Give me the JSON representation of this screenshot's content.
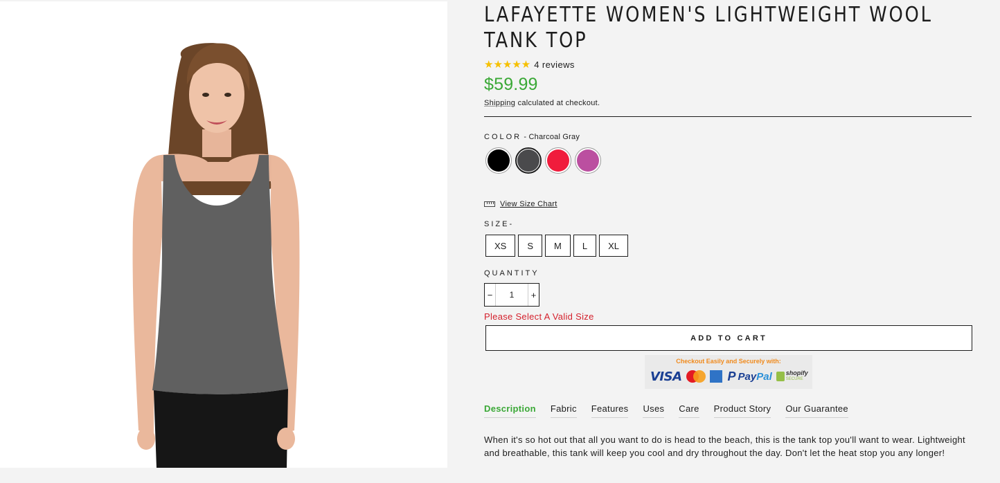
{
  "product": {
    "title": "LAFAYETTE WOMEN'S LIGHTWEIGHT WOOL TANK TOP",
    "stars": "★★★★★",
    "rating": 5,
    "reviews": "4 reviews",
    "price": "$59.99",
    "shipping_link": "Shipping",
    "shipping_text": " calculated at checkout.",
    "image_icon": "model-wearing-tank-top-photo"
  },
  "color": {
    "label": "COLOR",
    "separator": " - ",
    "selected": "Charcoal Gray",
    "swatches": [
      {
        "name": "Black",
        "hex": "#000000"
      },
      {
        "name": "Charcoal Gray",
        "hex": "#4a4a4c"
      },
      {
        "name": "Red",
        "hex": "#f01c3c"
      },
      {
        "name": "Magenta",
        "hex": "#bb4fa0"
      }
    ]
  },
  "size_chart": {
    "label": "View Size Chart",
    "icon": "ruler-icon"
  },
  "size": {
    "label": "SIZE",
    "separator": "-",
    "options": [
      "XS",
      "S",
      "M",
      "L",
      "XL"
    ]
  },
  "quantity": {
    "label": "QUANTITY",
    "minus": "−",
    "value": "1",
    "plus": "+"
  },
  "error": "Please Select A Valid Size",
  "add_to_cart": "ADD TO CART",
  "checkout_badge": {
    "caption": "Checkout Easily and Securely with:",
    "visa": "VISA",
    "paypal_p": "P",
    "paypal_a": "Pay",
    "paypal_b": "Pal",
    "shopify": "shopify",
    "shopify_sub": "SECURE"
  },
  "tabs": [
    {
      "label": "Description",
      "active": true
    },
    {
      "label": "Fabric",
      "active": false
    },
    {
      "label": "Features",
      "active": false
    },
    {
      "label": "Uses",
      "active": false
    },
    {
      "label": "Care",
      "active": false
    },
    {
      "label": "Product Story",
      "active": false
    },
    {
      "label": "Our Guarantee",
      "active": false
    }
  ],
  "description": "When it's so hot out that all you want to do is head to the beach, this is the tank top you'll want to wear. Lightweight and breathable, this tank will keep you cool and dry throughout the day. Don't let the heat stop you any longer!",
  "colors": {
    "price_green": "#3aa836",
    "error_red": "#d4202c",
    "star_yellow": "#f6c000"
  }
}
